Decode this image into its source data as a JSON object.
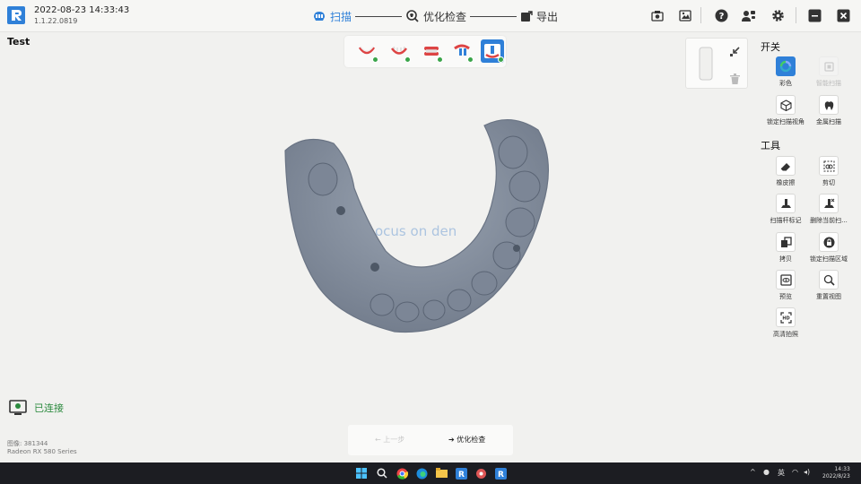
{
  "app": {
    "datetime": "2022-08-23 14:33:43",
    "version": "1.1.22.0819",
    "project_title": "Test"
  },
  "workflow": {
    "steps": [
      {
        "label": "扫描",
        "icon": "scan-icon",
        "active": true
      },
      {
        "label": "优化检查",
        "icon": "inspect-icon",
        "active": false
      },
      {
        "label": "导出",
        "icon": "export-icon",
        "active": false
      }
    ]
  },
  "scan_stages": [
    {
      "icon": "upper-jaw-icon",
      "done": true
    },
    {
      "icon": "lower-jaw-icon",
      "done": true
    },
    {
      "icon": "bite-icon",
      "done": true
    },
    {
      "icon": "upper-scanbody-icon",
      "done": true
    },
    {
      "icon": "lower-scanbody-icon",
      "done": true,
      "selected": true
    }
  ],
  "panel": {
    "switch_title": "开关",
    "switches": [
      {
        "label": "彩色",
        "icon": "color-icon",
        "state": "on"
      },
      {
        "label": "智能扫描",
        "icon": "smart-scan-icon",
        "state": "disabled"
      },
      {
        "label": "锁定扫描视角",
        "icon": "lock-view-icon",
        "state": "off"
      },
      {
        "label": "金属扫描",
        "icon": "metal-scan-icon",
        "state": "off"
      }
    ],
    "tools_title": "工具",
    "tools": [
      {
        "label": "橡皮擦",
        "icon": "eraser-icon"
      },
      {
        "label": "剪切",
        "icon": "cut-icon"
      },
      {
        "label": "扫描杆标记",
        "icon": "scanbody-mark-icon"
      },
      {
        "label": "删除当前扫...",
        "icon": "delete-scan-icon"
      },
      {
        "label": "拷贝",
        "icon": "copy-icon"
      },
      {
        "label": "锁定扫描区域",
        "icon": "lock-area-icon"
      },
      {
        "label": "预览",
        "icon": "preview-icon"
      },
      {
        "label": "重置视图",
        "icon": "reset-view-icon"
      },
      {
        "label": "高清拍照",
        "icon": "hd-photo-icon"
      }
    ]
  },
  "viewport": {
    "watermark": "ocus on den"
  },
  "status": {
    "connection": "已连接",
    "image_count": "图像: 381344",
    "gpu": "Radeon RX 580 Series"
  },
  "nav": {
    "prev_label": "上一步",
    "next_label": "优化检查"
  },
  "taskbar": {
    "ime": "英",
    "time": "14:33",
    "date": "2022/8/23"
  },
  "colors": {
    "accent": "#2f80d8",
    "connected": "#2b8a3e",
    "model": "#8c96a4"
  }
}
